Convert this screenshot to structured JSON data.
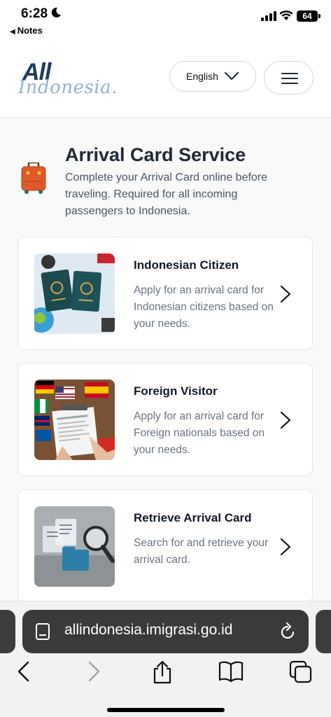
{
  "status_bar": {
    "time": "6:28",
    "back_app": "Notes",
    "battery": "64"
  },
  "header": {
    "logo_top": "All",
    "logo_bottom": "Indonesia.",
    "language": "English"
  },
  "intro": {
    "title": "Arrival Card Service",
    "description": "Complete your Arrival Card online before traveling. Required for all incoming passengers to Indonesia."
  },
  "cards": [
    {
      "title": "Indonesian Citizen",
      "description": "Apply for an arrival card for Indonesian citizens based on your needs."
    },
    {
      "title": "Foreign Visitor",
      "description": "Apply for an arrival card for Foreign nationals based on your needs."
    },
    {
      "title": "Retrieve Arrival Card",
      "description": "Search for and retrieve your arrival card."
    }
  ],
  "browser": {
    "url": "allindonesia.imigrasi.go.id"
  },
  "colors": {
    "brand_dark": "#1e3a5f",
    "brand_light": "#8fb3cf",
    "address_bar": "#3a3a3a"
  }
}
